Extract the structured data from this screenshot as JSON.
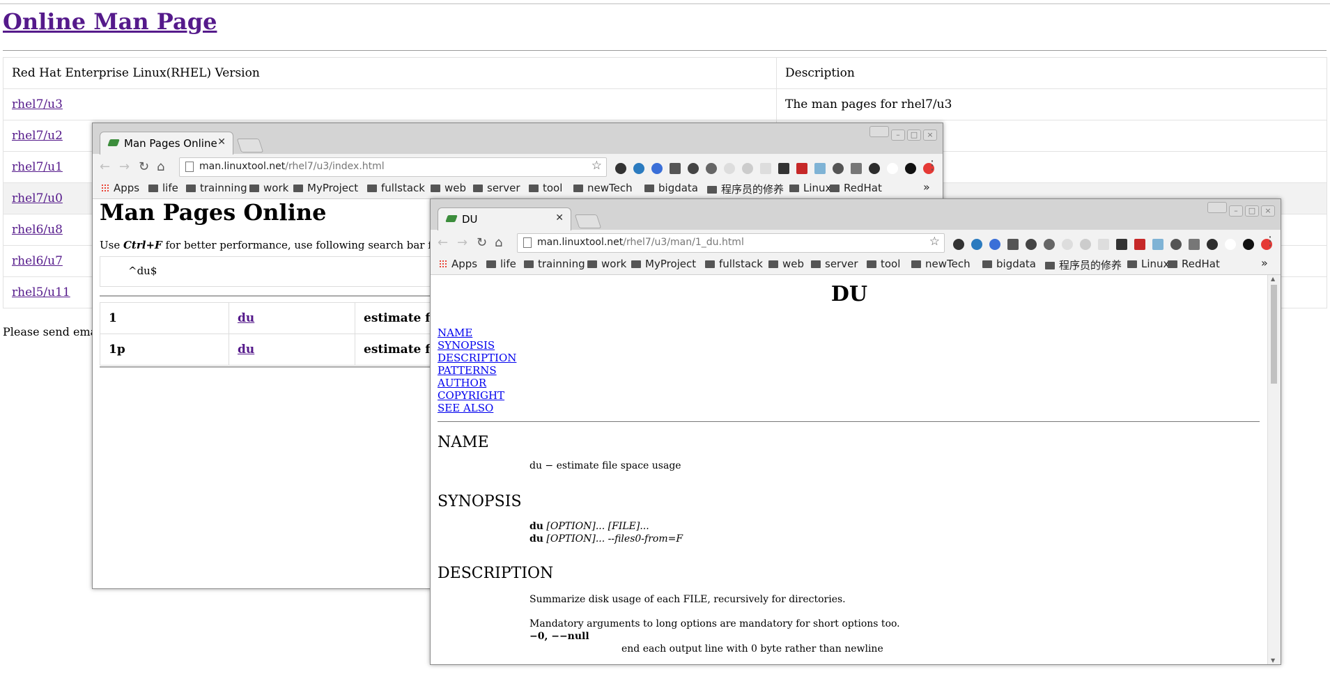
{
  "background_page": {
    "title": "Online Man Page",
    "table": {
      "header": [
        "Red Hat Enterprise Linux(RHEL) Version",
        "Description"
      ],
      "rows": [
        {
          "version": "rhel7/u3",
          "desc": "The man pages for rhel7/u3"
        },
        {
          "version": "rhel7/u2",
          "desc": ""
        },
        {
          "version": "rhel7/u1",
          "desc": ""
        },
        {
          "version": "rhel7/u0",
          "desc": ""
        },
        {
          "version": "rhel6/u8",
          "desc": ""
        },
        {
          "version": "rhel6/u7",
          "desc": ""
        },
        {
          "version": "rhel5/u11",
          "desc": ""
        }
      ]
    },
    "footer": "Please send emails to"
  },
  "bookmarks": {
    "items": [
      "Apps",
      "life",
      "trainning",
      "work",
      "MyProject",
      "fullstack",
      "web",
      "server",
      "tool",
      "newTech",
      "bigdata",
      "程序员的修养",
      "Linux",
      "RedHat"
    ],
    "more": "»"
  },
  "window1": {
    "tab_title": "Man Pages Online",
    "url_host": "man.linuxtool.net",
    "url_path": "/rhel7/u3/index.html",
    "heading": "Man Pages Online",
    "hint_prefix": "Use ",
    "hint_key": "Ctrl+F",
    "hint_suffix": " for better performance, use following search bar for better match.",
    "search_value": "^du$",
    "results": [
      {
        "section": "1",
        "name": "du",
        "desc": "estimate file sp"
      },
      {
        "section": "1p",
        "name": "du",
        "desc": "estimate file sp"
      }
    ]
  },
  "window2": {
    "tab_title": "DU",
    "url_host": "man.linuxtool.net",
    "url_path": "/rhel7/u3/man/1_du.html",
    "title": "DU",
    "toc": [
      "NAME",
      "SYNOPSIS",
      "DESCRIPTION",
      "PATTERNS",
      "AUTHOR",
      "COPYRIGHT",
      "SEE ALSO"
    ],
    "name_heading": "NAME",
    "name_text": "du − estimate file space usage",
    "synopsis_heading": "SYNOPSIS",
    "syn1_cmd": "du",
    "syn1_rest": " [OPTION]... [FILE]...",
    "syn2_cmd": "du",
    "syn2_rest": " [OPTION]... --files0-from=F",
    "description_heading": "DESCRIPTION",
    "desc1": "Summarize disk usage of each FILE, recursively for directories.",
    "desc2": "Mandatory arguments to long options are mandatory for short options too.",
    "opt": "−0, −−null",
    "opt_desc": "end each output line with 0 byte rather than newline"
  },
  "icons": {
    "back": "←",
    "forward": "→",
    "reload": "↻",
    "home": "⌂",
    "star": "☆",
    "menu": "⋮",
    "close": "✕"
  }
}
